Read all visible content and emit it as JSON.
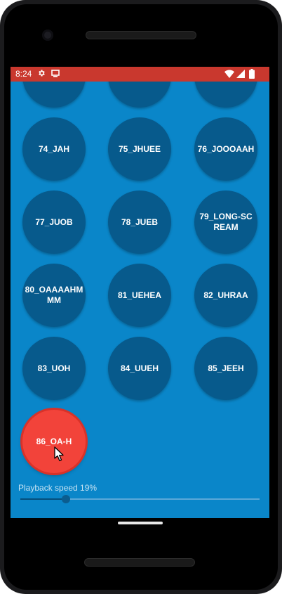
{
  "status_bar": {
    "time": "8:24",
    "icons": [
      "gear-icon",
      "sdcard-icon",
      "wifi-icon",
      "signal-icon",
      "battery-icon"
    ]
  },
  "sounds": [
    {
      "label": ""
    },
    {
      "label": ""
    },
    {
      "label": ""
    },
    {
      "label": "74_JAH"
    },
    {
      "label": "75_JHUEE"
    },
    {
      "label": "76_JOOOAAH"
    },
    {
      "label": "77_JUOB"
    },
    {
      "label": "78_JUEB"
    },
    {
      "label": "79_LONG-SCREAM"
    },
    {
      "label": "80_OAAAAHMMM"
    },
    {
      "label": "81_UEHEA"
    },
    {
      "label": "82_UHRAA"
    },
    {
      "label": "83_UOH"
    },
    {
      "label": "84_UUEH"
    },
    {
      "label": "85_JEEH"
    },
    {
      "label": "86_OA-H",
      "active": true
    }
  ],
  "playback": {
    "label": "Playback speed 19%",
    "value": 0.19
  },
  "colors": {
    "status_bar": "#c9382e",
    "background": "#0a86c9",
    "button": "#075a8c",
    "button_active": "#f2433a"
  }
}
